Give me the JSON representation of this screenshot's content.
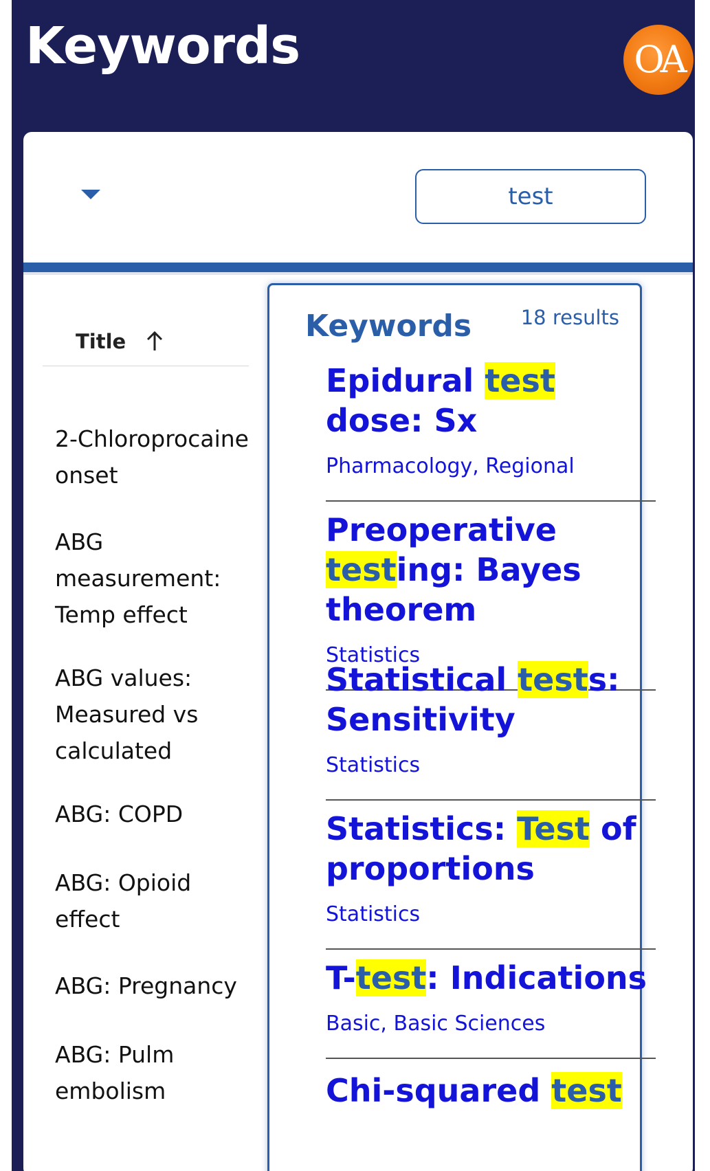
{
  "header": {
    "title": "Keywords",
    "logo_text": "OA"
  },
  "search": {
    "value": "test"
  },
  "table": {
    "column_header": "Title",
    "rows": [
      "2-Chloroprocaine onset",
      "ABG measurement: Temp effect",
      "ABG values: Measured vs calculated",
      "ABG: COPD",
      "ABG: Opioid effect",
      "ABG: Pregnancy",
      "ABG: Pulm embolism"
    ]
  },
  "popup": {
    "title": "Keywords",
    "count": "18 results",
    "results": [
      {
        "title_parts": [
          "Epidural ",
          "test",
          " dose: Sx"
        ],
        "tags": "Pharmacology, Regional"
      },
      {
        "title_parts": [
          "Preoperative ",
          "test",
          "ing: Bayes theorem"
        ],
        "tags": "Statistics"
      },
      {
        "title_parts": [
          "Statistical ",
          "test",
          "s: Sensitivity"
        ],
        "tags": "Statistics"
      },
      {
        "title_parts": [
          "Statistics: ",
          "Test",
          " of proportions"
        ],
        "tags": "Statistics"
      },
      {
        "title_parts": [
          "T-",
          "test",
          ": Indications"
        ],
        "tags": "Basic, Basic Sciences"
      },
      {
        "title_parts": [
          "Chi-squared ",
          "test",
          ""
        ],
        "tags": ""
      }
    ]
  },
  "colors": {
    "header_bg": "#1b1f55",
    "accent": "#2a5ea8",
    "link": "#1414d8",
    "highlight": "#ffff00",
    "logo": "#f27a12"
  }
}
